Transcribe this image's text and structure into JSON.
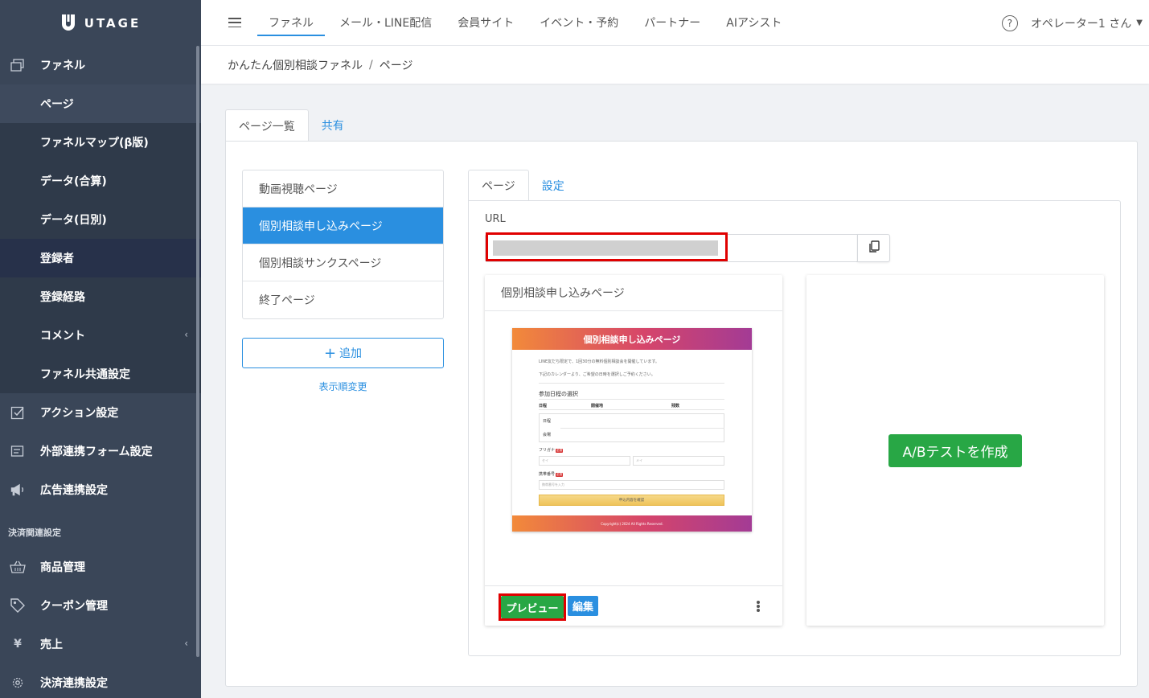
{
  "brand": {
    "logo_text": "UTAGE"
  },
  "sidebar": {
    "items": [
      {
        "label": "ファネル",
        "icon": "window-icon"
      },
      {
        "label": "ページ"
      },
      {
        "label": "ファネルマップ(β版)"
      },
      {
        "label": "データ(合算)"
      },
      {
        "label": "データ(日別)"
      },
      {
        "label": "登録者"
      },
      {
        "label": "登録経路"
      },
      {
        "label": "コメント",
        "chevron": "‹"
      },
      {
        "label": "ファネル共通設定"
      },
      {
        "label": "アクション設定",
        "icon": "checkbox-icon"
      },
      {
        "label": "外部連携フォーム設定",
        "icon": "form-icon"
      },
      {
        "label": "広告連携設定",
        "icon": "megaphone-icon"
      }
    ],
    "section_payment": "決済関連設定",
    "payment_items": [
      {
        "label": "商品管理",
        "icon": "basket-icon"
      },
      {
        "label": "クーポン管理",
        "icon": "tag-icon"
      },
      {
        "label": "売上",
        "icon": "yen-icon",
        "chevron": "‹"
      },
      {
        "label": "決済連携設定",
        "icon": "gear-icon"
      }
    ]
  },
  "topnav": {
    "items": [
      "ファネル",
      "メール・LINE配信",
      "会員サイト",
      "イベント・予約",
      "パートナー",
      "AIアシスト"
    ],
    "help": "?",
    "user": "オペレーター1 さん"
  },
  "breadcrumb": {
    "parent": "かんたん個別相談ファネル",
    "sep": "/",
    "current": "ページ"
  },
  "main_tabs": [
    "ページ一覧",
    "共有"
  ],
  "page_list": [
    "動画視聴ページ",
    "個別相談申し込みページ",
    "個別相談サンクスページ",
    "終了ページ"
  ],
  "add_button": {
    "plus": "+",
    "label": "追加"
  },
  "reorder_link": "表示順変更",
  "detail_tabs": [
    "ページ",
    "設定"
  ],
  "url": {
    "label": "URL",
    "value": ""
  },
  "preview_card": {
    "title": "個別相談申し込みページ",
    "preview_button": "プレビュー",
    "edit_button": "編集"
  },
  "thumbnail": {
    "header": "個別相談申し込みページ",
    "line1": "LINE友だち限定で、1回30分の無料個別相談会を開催しています。",
    "line2": "下記のカレンダーより、ご希望の日時を選択しご予約ください。",
    "section": "参加日程の選択",
    "col1": "日程",
    "col2": "開催地",
    "col3": "残数",
    "row1": "日程",
    "row2": "会場",
    "furigana": "フリガナ",
    "sei": "セイ",
    "mei": "メイ",
    "phone": "携帯番号",
    "phone_ph": "携帯番号を入力",
    "required": "必須",
    "submit": "申込内容を確認",
    "footer": "Copyright(c) 2024 All Rights Reserved."
  },
  "ab_test": {
    "label": "A/Bテストを作成"
  },
  "colors": {
    "sidebar": "#3a4658",
    "primary": "#2a8fe0",
    "success": "#28a745",
    "highlight": "#e00000"
  }
}
